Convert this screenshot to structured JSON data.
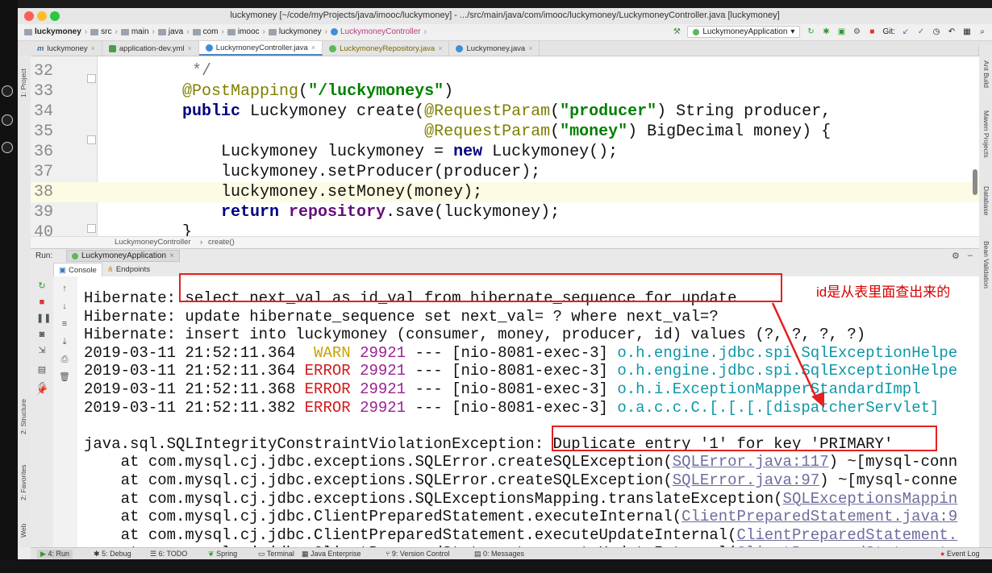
{
  "window_title": "luckymoney [~/code/myProjects/java/imooc/luckymoney] - .../src/main/java/com/imooc/luckymoney/LuckymoneyController.java [luckymoney]",
  "navbar": {
    "crumbs": [
      "luckymoney",
      "src",
      "main",
      "java",
      "com",
      "imooc",
      "luckymoney",
      "LuckymoneyController"
    ],
    "run_config": "LuckymoneyApplication",
    "git_label": "Git:"
  },
  "tabs": [
    {
      "label": "luckymoney",
      "icon": "m-icon"
    },
    {
      "label": "application-dev.yml",
      "icon": "yml-icon"
    },
    {
      "label": "LuckymoneyController.java",
      "icon": "class-icon",
      "active": true
    },
    {
      "label": "LuckymoneyRepository.java",
      "icon": "interface-icon"
    },
    {
      "label": "Luckymoney.java",
      "icon": "class-icon"
    }
  ],
  "left_tool_windows": [
    "1: Project",
    "2: Structure",
    "2: Favorites",
    "Web"
  ],
  "right_tool_windows": [
    "Ant Build",
    "Maven Projects",
    "Database",
    "Bean Validation"
  ],
  "editor": {
    "lines": [
      {
        "num": "32",
        "text": "     */"
      },
      {
        "num": "33",
        "text": "    @PostMapping(\"/luckymoneys\")"
      },
      {
        "num": "34",
        "text": "    public Luckymoney create(@RequestParam(\"producer\") String producer,"
      },
      {
        "num": "35",
        "text": "                             @RequestParam(\"money\") BigDecimal money) {"
      },
      {
        "num": "36",
        "text": "        Luckymoney luckymoney = new Luckymoney();"
      },
      {
        "num": "37",
        "text": "        luckymoney.setProducer(producer);"
      },
      {
        "num": "38",
        "text": "        luckymoney.setMoney(money);"
      },
      {
        "num": "39",
        "text": "        return repository.save(luckymoney);"
      },
      {
        "num": "40",
        "text": "    }"
      }
    ],
    "breadcrumb": [
      "LuckymoneyController",
      "create()"
    ]
  },
  "run_panel": {
    "label": "Run:",
    "app": "LuckymoneyApplication",
    "subtabs": [
      "Console",
      "Endpoints"
    ]
  },
  "console": {
    "lines": [
      "Hibernate: select next_val as id_val from hibernate_sequence for update",
      "Hibernate: update hibernate_sequence set next_val= ? where next_val=?",
      "Hibernate: insert into luckymoney (consumer, money, producer, id) values (?, ?, ?, ?)",
      "2019-03-11 21:52:11.364  WARN 29921 --- [nio-8081-exec-3] o.h.engine.jdbc.spi.SqlExceptionHelpe",
      "2019-03-11 21:52:11.364 ERROR 29921 --- [nio-8081-exec-3] o.h.engine.jdbc.spi.SqlExceptionHelpe",
      "2019-03-11 21:52:11.368 ERROR 29921 --- [nio-8081-exec-3] o.h.i.ExceptionMapperStandardImpl",
      "2019-03-11 21:52:11.382 ERROR 29921 --- [nio-8081-exec-3] o.a.c.c.C.[.[.[.[dispatcherServlet]",
      "",
      "java.sql.SQLIntegrityConstraintViolationException: Duplicate entry '1' for key 'PRIMARY'",
      "    at com.mysql.cj.jdbc.exceptions.SQLError.createSQLException(SQLError.java:117) ~[mysql-conn",
      "    at com.mysql.cj.jdbc.exceptions.SQLError.createSQLException(SQLError.java:97) ~[mysql-conne",
      "    at com.mysql.cj.jdbc.exceptions.SQLExceptionsMapping.translateException(SQLExceptionsMappin",
      "    at com.mysql.cj.jdbc.ClientPreparedStatement.executeInternal(ClientPreparedStatement.java:9",
      "    at com.mysql.cj.jdbc.ClientPreparedStatement.executeUpdateInternal(ClientPreparedStatement.",
      "    at com.mysql.cj.jdbc.ClientPreparedStatement.executeUpdateInternal(ClientPreparedStatement."
    ]
  },
  "annotation_note": "id是从表里面查出来的",
  "bottom_tools": [
    "4: Run",
    "5: Debug",
    "6: TODO",
    "Spring",
    "Terminal",
    "Java Enterprise",
    "9: Version Control",
    "0: Messages",
    "Event Log"
  ],
  "colors": {
    "highlight_box": "#e52020",
    "note_text": "#d40000",
    "current_line": "#fdfbe3"
  }
}
